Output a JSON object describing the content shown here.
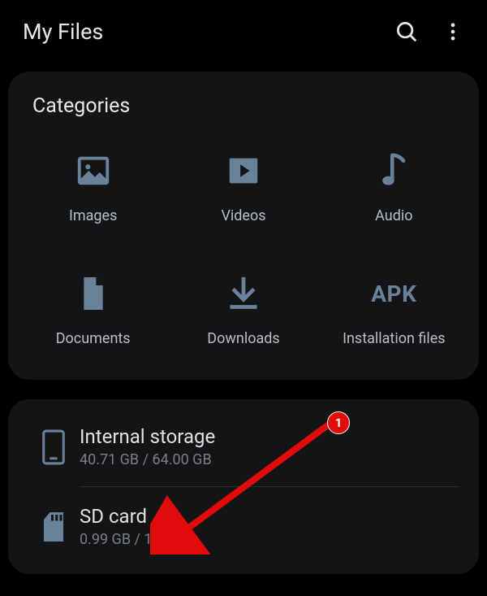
{
  "header": {
    "title": "My Files"
  },
  "categories": {
    "title": "Categories",
    "items": [
      {
        "label": "Images"
      },
      {
        "label": "Videos"
      },
      {
        "label": "Audio"
      },
      {
        "label": "Documents"
      },
      {
        "label": "Downloads"
      },
      {
        "label": "Installation files"
      }
    ]
  },
  "storage": {
    "internal": {
      "title": "Internal storage",
      "sub": "40.71 GB / 64.00 GB"
    },
    "sdcard": {
      "title": "SD card",
      "sub": "0.99 GB / 1.86 GB"
    }
  },
  "annotation": {
    "badge": "1"
  }
}
